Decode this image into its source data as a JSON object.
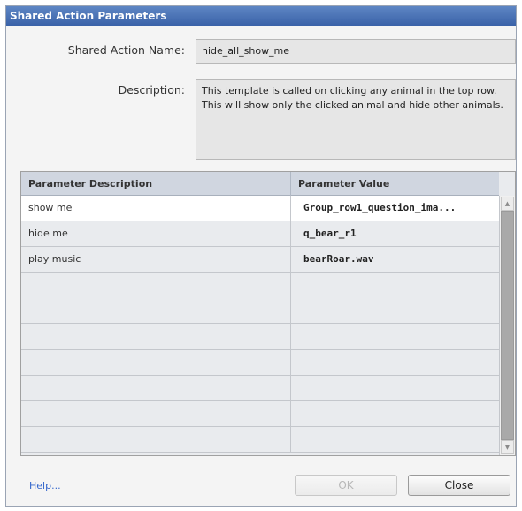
{
  "dialog": {
    "title": "Shared Action Parameters"
  },
  "form": {
    "name_label": "Shared Action Name:",
    "name_value": "hide_all_show_me",
    "description_label": "Description:",
    "description_value": "This template is called on clicking any animal in the top row. This will show only the clicked animal and hide other animals."
  },
  "grid": {
    "columns": [
      "Parameter Description",
      "Parameter Value"
    ],
    "rows": [
      {
        "description": "show me",
        "value": "Group_row1_question_ima..."
      },
      {
        "description": "hide me",
        "value": "q_bear_r1"
      },
      {
        "description": "play music",
        "value": "bearRoar.wav"
      },
      {
        "description": "",
        "value": ""
      },
      {
        "description": "",
        "value": ""
      },
      {
        "description": "",
        "value": ""
      },
      {
        "description": "",
        "value": ""
      },
      {
        "description": "",
        "value": ""
      },
      {
        "description": "",
        "value": ""
      },
      {
        "description": "",
        "value": ""
      }
    ],
    "selected_row": 0
  },
  "footer": {
    "help_label": "Help...",
    "ok_label": "OK",
    "close_label": "Close"
  },
  "colors": {
    "title_bar": "#3a62a8",
    "header_bg": "#d0d6e0",
    "link": "#3366cc"
  }
}
